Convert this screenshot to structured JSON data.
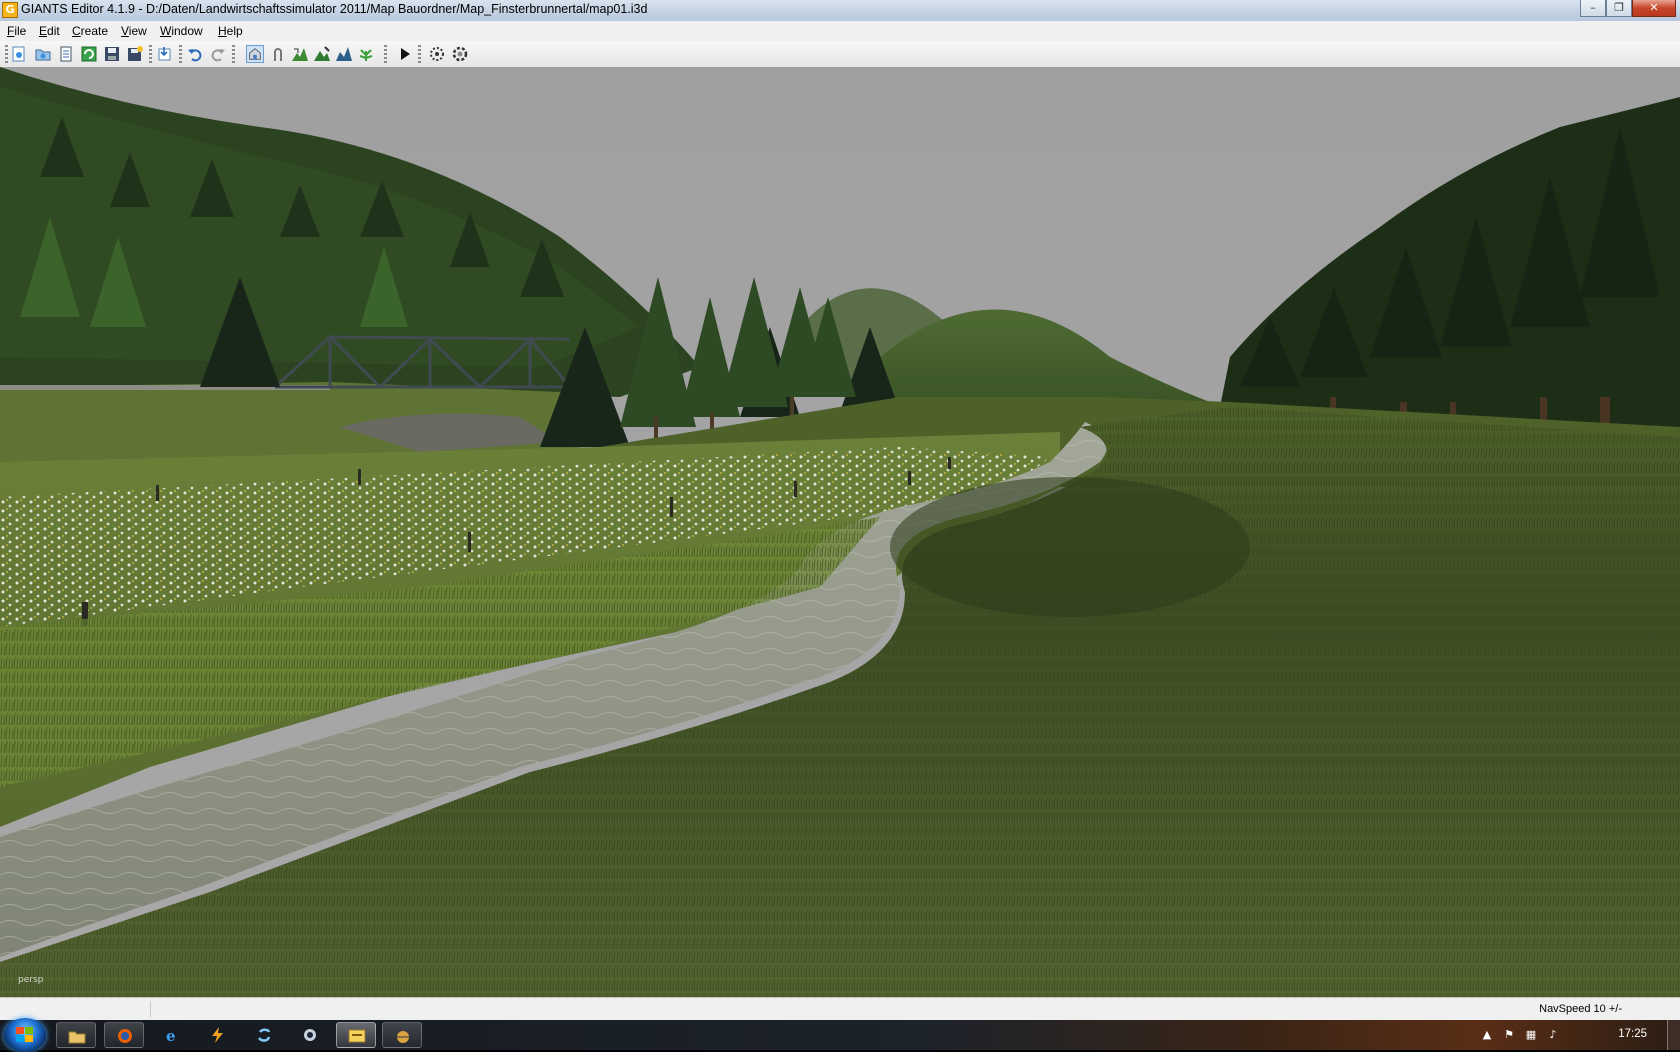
{
  "window": {
    "title": "GIANTS Editor 4.1.9 - D:/Daten/Landwirtschaftssimulator 2011/Map Bauordner/Map_Finsterbrunnertal/map01.i3d",
    "minimize_icon": "minimize-icon",
    "maximize_icon": "restore-icon",
    "close_icon": "close-icon"
  },
  "menu": {
    "items": [
      "File",
      "Edit",
      "Create",
      "View",
      "Window",
      "Help"
    ]
  },
  "toolbar": {
    "buttons": [
      "new-scene-icon",
      "open-icon",
      "properties-icon",
      "refresh-icon",
      "save-icon",
      "save-as-icon",
      "export-icon",
      "undo-icon",
      "redo-icon",
      "select-mode-icon",
      "move-mode-icon",
      "terrain-sculpt-icon",
      "terrain-paint-icon",
      "terrain-smooth-icon",
      "foliage-paint-icon",
      "play-icon",
      "particle-icon",
      "settings-icon"
    ]
  },
  "viewport": {
    "camera_label": "persp"
  },
  "statusbar": {
    "navspeed": "NavSpeed 10 +/-"
  },
  "taskbar": {
    "start_icon": "windows-start-icon",
    "apps": [
      "explorer-icon",
      "firefox-icon",
      "internet-explorer-icon",
      "winamp-icon",
      "skype-icon",
      "steam-icon",
      "file-manager-icon",
      "giants-editor-icon"
    ],
    "tray": [
      "show-hidden-icons-icon",
      "action-center-flag-icon",
      "network-icon",
      "volume-icon"
    ],
    "clock": "17:25"
  },
  "colors": {
    "sky": "#a2a2a2",
    "forest": "#2f4a22",
    "meadow": "#5a6e2c",
    "water": "#8f9484",
    "taskbar": "#1d232b"
  }
}
